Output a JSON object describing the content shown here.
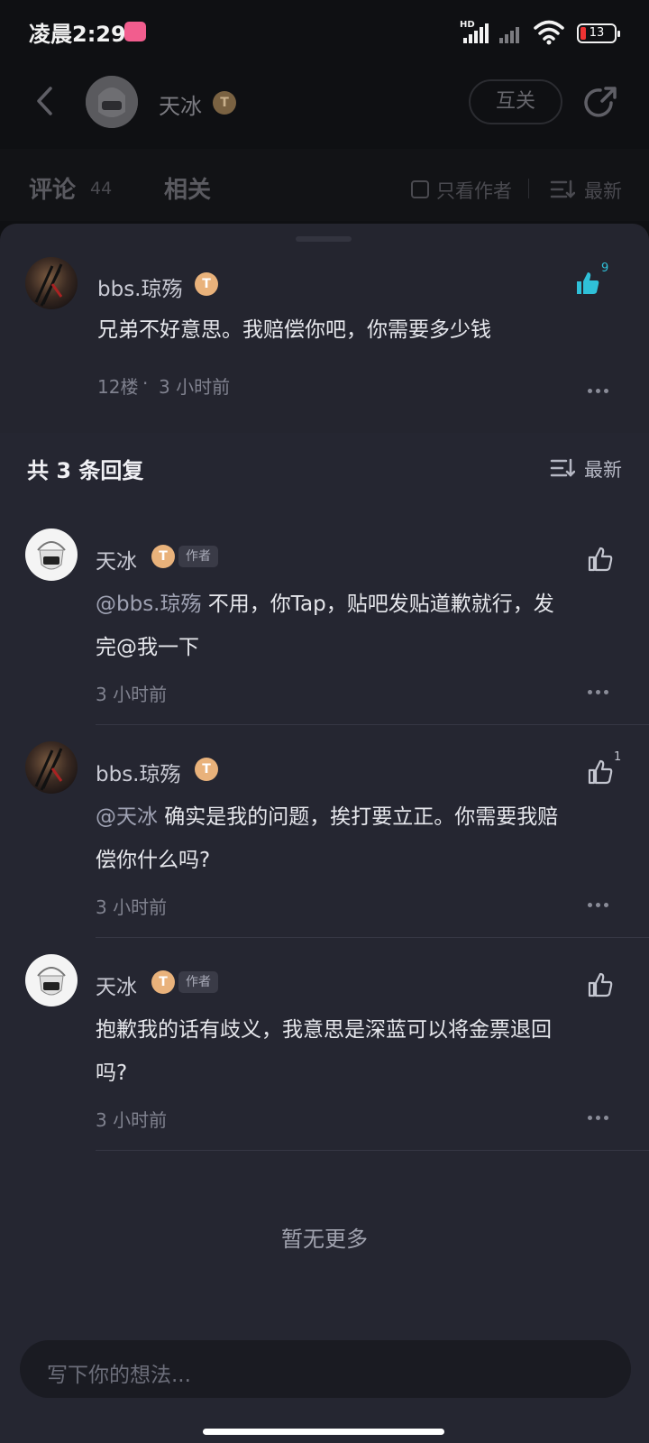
{
  "status_bar": {
    "time": "凌晨2:29",
    "hd": "HD",
    "battery": "13"
  },
  "header": {
    "name": "天冰",
    "badge": "T",
    "follow_label": "互关"
  },
  "tabs": {
    "comment_label": "评论",
    "comment_count": "44",
    "related_label": "相关",
    "author_only_label": "只看作者",
    "sort_label": "最新"
  },
  "main_comment": {
    "username": "bbs.琼殇",
    "badge": "T",
    "like_count": "9",
    "text": "兄弟不好意思。我赔偿你吧，你需要多少钱",
    "floor": "12楼",
    "dot": "·",
    "time": "3 小时前"
  },
  "replies_header": {
    "title": "共 3 条回复",
    "sort_label": "最新"
  },
  "replies": [
    {
      "username": "天冰",
      "badge": "T",
      "author_tag": "作者",
      "mention": "@bbs.琼殇",
      "line1": " 不用，你Tap，贴吧发贴道歉就行，发",
      "line2": "完@我一下",
      "time": "3 小时前",
      "like_count": ""
    },
    {
      "username": "bbs.琼殇",
      "badge": "T",
      "mention": "@天冰",
      "line1": " 确实是我的问题，挨打要立正。你需要我赔",
      "line2": "偿你什么吗?",
      "time": "3 小时前",
      "like_count": "1"
    },
    {
      "username": "天冰",
      "badge": "T",
      "author_tag": "作者",
      "line1": "抱歉我的话有歧义，我意思是深蓝可以将金票退回",
      "line2": "吗?",
      "time": "3 小时前",
      "like_count": ""
    }
  ],
  "no_more": "暂无更多",
  "input": {
    "placeholder": "写下你的想法..."
  },
  "colors": {
    "accent_like": "#2fc0d8",
    "badge": "#e9b27b",
    "sheet_bg": "#24252f"
  },
  "icons": [
    "back-arrow-icon",
    "share-icon",
    "checkbox-icon",
    "sort-icon",
    "thumb-up-icon",
    "more-dots-icon"
  ]
}
